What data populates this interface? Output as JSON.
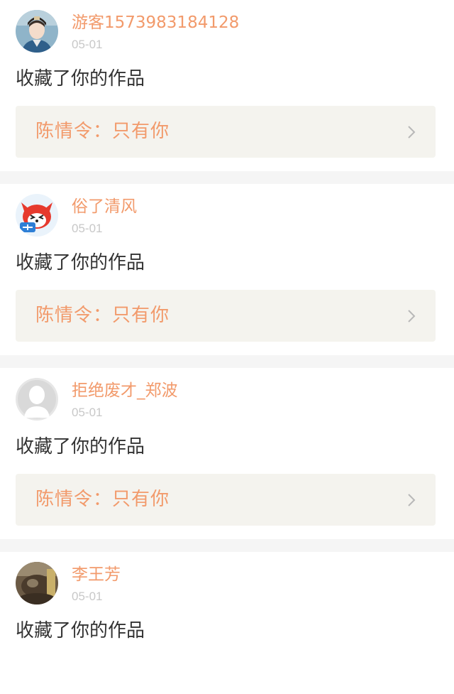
{
  "notifications": [
    {
      "username": "游客1573983184128",
      "date": "05-01",
      "action": "收藏了你的作品",
      "work_title": "陈情令：只有你",
      "avatar_icon": "avatar-costume-icon"
    },
    {
      "username": "俗了清风",
      "date": "05-01",
      "action": "收藏了你的作品",
      "work_title": "陈情令：只有你",
      "avatar_icon": "avatar-red-fox-icon"
    },
    {
      "username": "拒绝废才_郑波",
      "date": "05-01",
      "action": "收藏了你的作品",
      "work_title": "陈情令：只有你",
      "avatar_icon": "avatar-default-icon"
    },
    {
      "username": "李王芳",
      "date": "05-01",
      "action": "收藏了你的作品",
      "avatar_icon": "avatar-photo-icon"
    }
  ],
  "colors": {
    "accent": "#f29a6b",
    "date": "#c8c8c8",
    "text": "#333333",
    "link_bg": "#f4f3ee",
    "separator": "#f5f5f5"
  }
}
